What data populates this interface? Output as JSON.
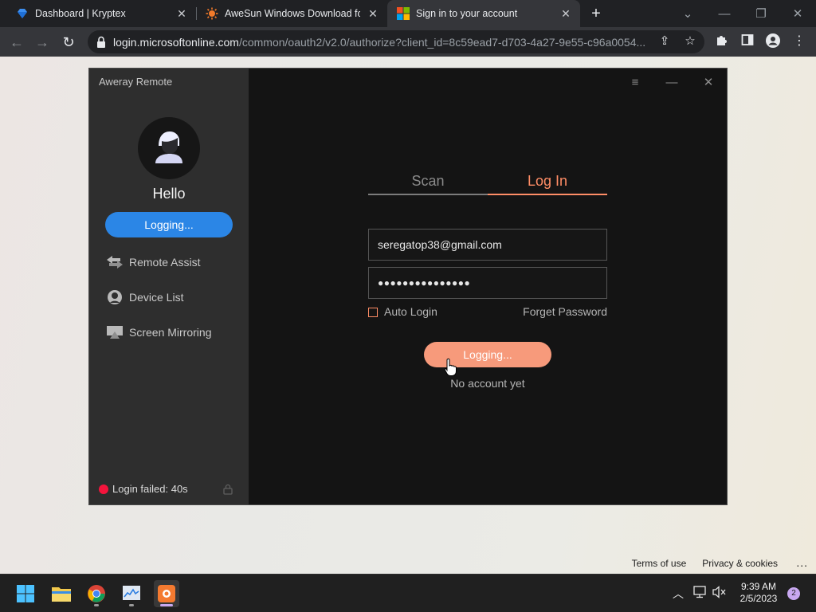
{
  "browser": {
    "tabs": [
      {
        "title": "Dashboard | Kryptex",
        "icon": "kryptex-diamond-icon"
      },
      {
        "title": "AweSun Windows Download for",
        "icon": "awesun-sun-icon"
      },
      {
        "title": "Sign in to your account",
        "icon": "microsoft-logo-icon",
        "active": true
      }
    ],
    "url_host": "login.microsoftonline.com",
    "url_path": "/common/oauth2/v2.0/authorize?client_id=8c59ead7-d703-4a27-9e55-c96a0054...",
    "colors": {
      "frame": "#202124",
      "toolbar": "#35363a"
    }
  },
  "page": {
    "footer": {
      "terms": "Terms of use",
      "privacy": "Privacy & cookies",
      "more": "..."
    }
  },
  "app": {
    "title": "Aweray Remote",
    "greeting": "Hello",
    "side_button": "Logging...",
    "nav": [
      {
        "label": "Remote Assist",
        "icon": "remote-assist-arrows-icon"
      },
      {
        "label": "Device List",
        "icon": "device-list-icon"
      },
      {
        "label": "Screen Mirroring",
        "icon": "screen-mirroring-icon"
      }
    ],
    "status": "Login failed: 40s",
    "tabs": {
      "scan": "Scan",
      "login": "Log In"
    },
    "email": "seregatop38@gmail.com",
    "password_mask": "●●●●●●●●●●●●●●●",
    "auto_login": "Auto Login",
    "forget_password": "Forget Password",
    "login_button": "Logging...",
    "no_account": "No account yet",
    "colors": {
      "accent": "#ff8d66",
      "button": "#f79a7b",
      "blue": "#2b86e6",
      "error": "#f4143c"
    }
  },
  "taskbar": {
    "apps": [
      "windows-start-icon",
      "file-explorer-icon",
      "chrome-icon",
      "task-manager-icon",
      "aweray-icon"
    ],
    "time": "9:39 AM",
    "date": "2/5/2023",
    "notifications": "2"
  }
}
